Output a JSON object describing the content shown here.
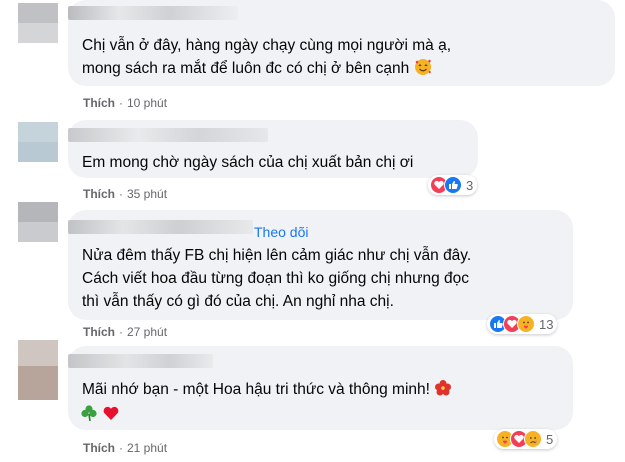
{
  "comments": [
    {
      "lines": [
        "Chị vẫn ở đây, hàng ngày chạy cùng mọi người mà ạ,",
        "mong sách ra mắt để luôn đc có chị ở bên cạnh"
      ],
      "like_label": "Thích",
      "time": "10 phút",
      "trailing_emoji": "smiling-face-with-hearts-icon"
    },
    {
      "lines": [
        "Em mong chờ ngày sách của chị xuất bản chị ơi"
      ],
      "like_label": "Thích",
      "time": "35 phút",
      "reactions": [
        "love-icon",
        "like-icon"
      ],
      "reaction_count": "3"
    },
    {
      "follow_label": "Theo dõi",
      "lines": [
        "Nửa đêm thấy FB chị hiện lên cảm giác như chị vẫn đây.",
        "Cách viết hoa đầu từng đoạn thì ko giống chị nhưng đọc",
        "thì vẫn thấy có gì đó của chị. An nghỉ nha chị."
      ],
      "like_label": "Thích",
      "time": "27 phút",
      "reactions": [
        "like-icon",
        "love-icon",
        "care-icon"
      ],
      "reaction_count": "13"
    },
    {
      "lines": [
        "Mãi nhớ bạn - một Hoa hậu tri thức và thông minh!"
      ],
      "line1_emoji": "hibiscus-icon",
      "line2_emojis": [
        "shamrock-icon",
        "red-heart-icon"
      ],
      "like_label": "Thích",
      "time": "21 phút",
      "reactions": [
        "care-icon",
        "love-icon",
        "sad-icon"
      ],
      "reaction_count": "5"
    }
  ],
  "colors": {
    "bubble": "#f0f2f5",
    "meta_text": "#65676b",
    "link_blue": "#1877f2",
    "like_blue": "#1877f2",
    "love_red": "#f33e58",
    "care_yellow": "#f7b125"
  }
}
